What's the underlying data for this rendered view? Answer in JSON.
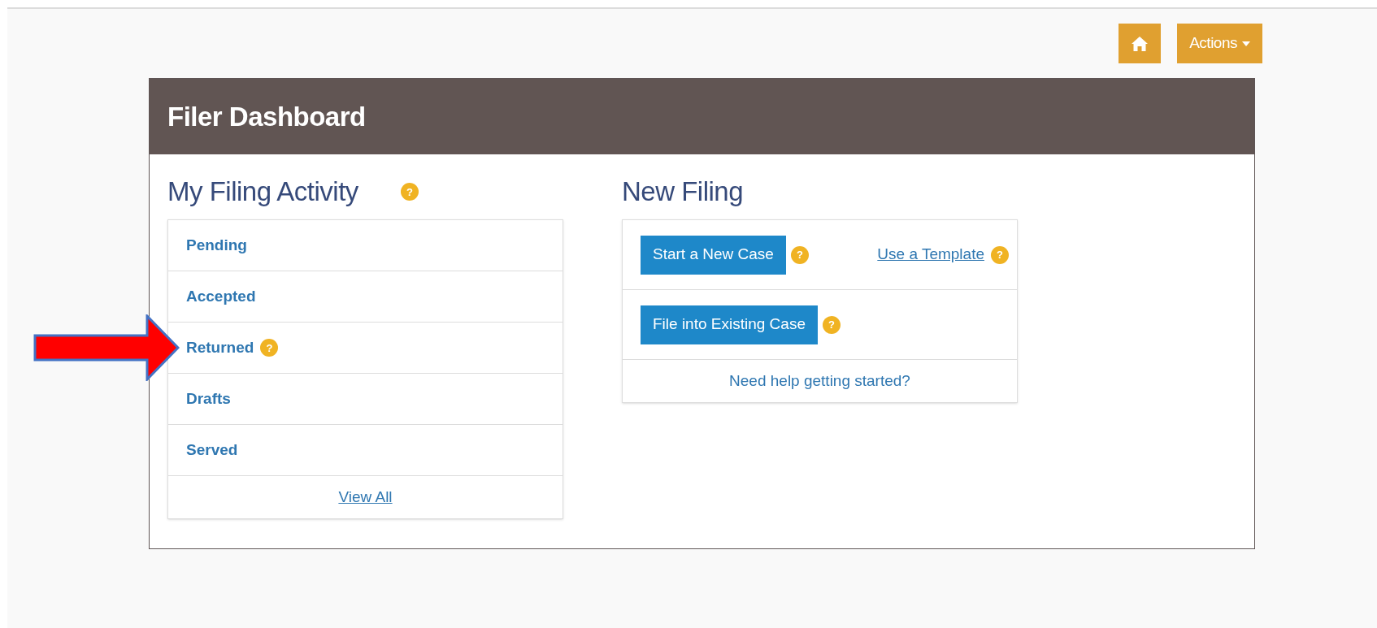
{
  "toolbar": {
    "home_button": {
      "kind": "home"
    },
    "actions_button": {
      "label": "Actions"
    }
  },
  "dashboard": {
    "title": "Filer Dashboard",
    "activity": {
      "heading": "My Filing Activity",
      "help": "?",
      "items": [
        {
          "label": "Pending"
        },
        {
          "label": "Accepted"
        },
        {
          "label": "Returned",
          "help": "?",
          "highlighted": true
        },
        {
          "label": "Drafts"
        },
        {
          "label": "Served"
        }
      ],
      "footer_link": "View All"
    },
    "new_filing": {
      "heading": "New Filing",
      "rows": [
        {
          "button": "Start a New Case",
          "help": "?",
          "link": "Use a Template",
          "link_help": "?"
        },
        {
          "button": "File into Existing Case",
          "help": "?"
        }
      ],
      "footer_link": "Need help getting started?"
    }
  }
}
